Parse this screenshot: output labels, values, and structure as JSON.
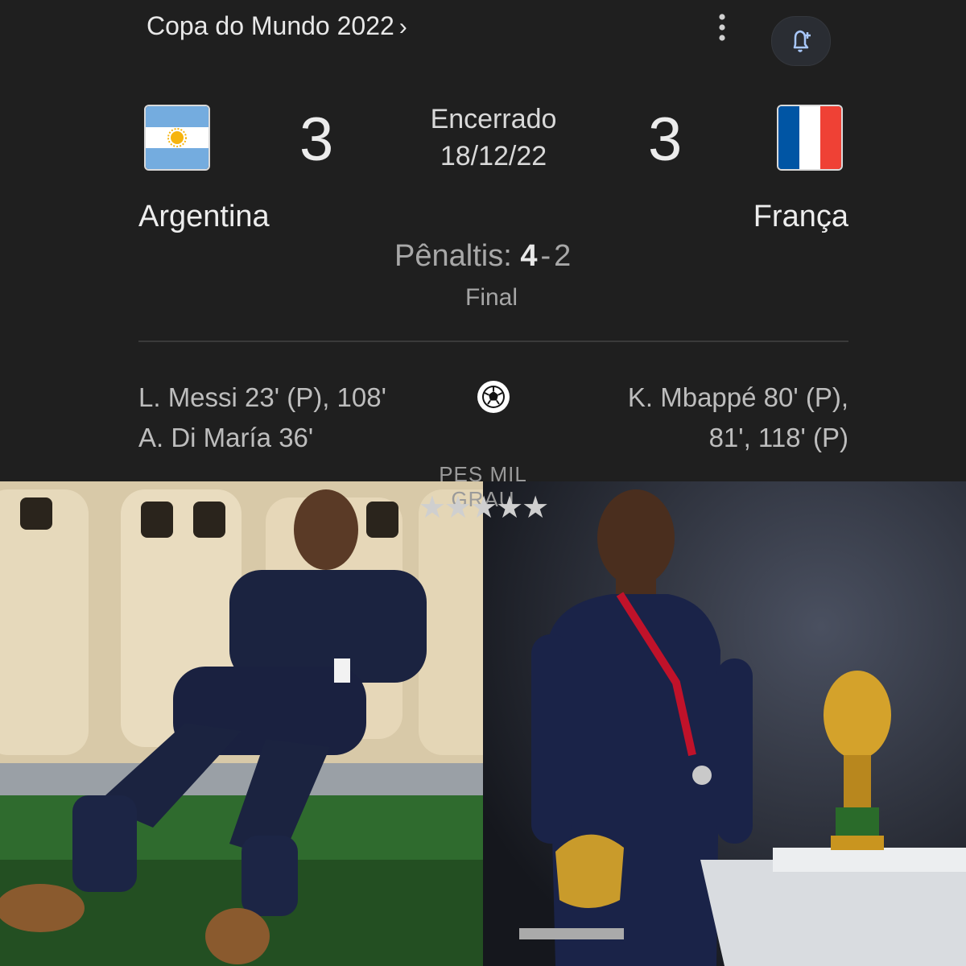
{
  "header": {
    "competition": "Copa do Mundo 2022",
    "chevron": "›",
    "more_icon": "more-vert-icon",
    "follow_icon": "bell-plus-icon"
  },
  "match": {
    "status": "Encerrado",
    "date": "18/12/22",
    "home": {
      "name": "Argentina",
      "score": "3"
    },
    "away": {
      "name": "França",
      "score": "3"
    },
    "penalties": {
      "label": "Pênaltis:",
      "home": "4",
      "separator": "-",
      "away": "2"
    },
    "stage": "Final",
    "home_scorers": [
      "L. Messi 23' (P), 108'",
      "A. Di María 36'"
    ],
    "away_scorers": [
      "K. Mbappé 80' (P),",
      "81', 118' (P)"
    ]
  },
  "watermark": {
    "text": "PES MIL GRAU",
    "stars": "★★★★★"
  },
  "colors": {
    "background": "#1f1f1f",
    "argentina_blue": "#74acdf",
    "france_blue": "#0055a4",
    "france_red": "#ef4135"
  }
}
